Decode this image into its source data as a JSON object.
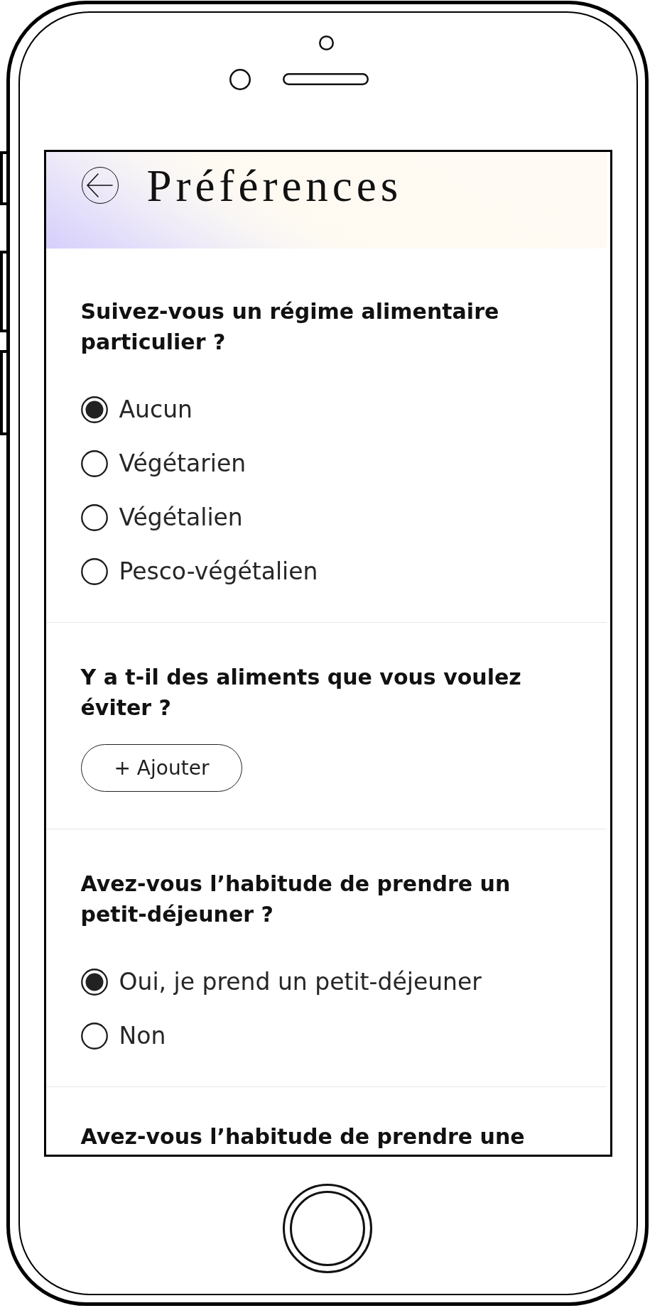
{
  "header": {
    "title": "Préférences"
  },
  "sections": [
    {
      "kind": "radio",
      "question": "Suivez-vous un régime alimentaire particulier ?",
      "options": [
        {
          "label": "Aucun",
          "selected": true
        },
        {
          "label": "Végétarien",
          "selected": false
        },
        {
          "label": "Végétalien",
          "selected": false
        },
        {
          "label": "Pesco-végétalien",
          "selected": false
        }
      ]
    },
    {
      "kind": "add",
      "question": "Y a t-il des aliments que vous voulez éviter ?",
      "button": "+ Ajouter"
    },
    {
      "kind": "radio",
      "question": "Avez-vous l’habitude de prendre un petit-déjeuner ?",
      "options": [
        {
          "label": "Oui, je prend un petit-déjeuner",
          "selected": true
        },
        {
          "label": "Non",
          "selected": false
        }
      ]
    },
    {
      "kind": "question",
      "question": "Avez-vous l’habitude de prendre une"
    }
  ]
}
